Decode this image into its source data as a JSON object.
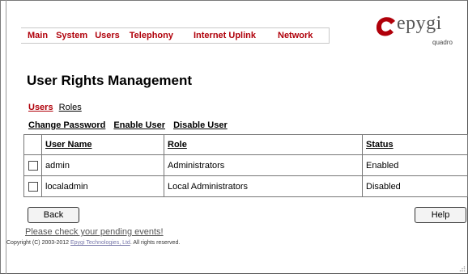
{
  "nav": {
    "items": [
      {
        "label": "Main"
      },
      {
        "label": "System"
      },
      {
        "label": "Users"
      },
      {
        "label": "Telephony"
      },
      {
        "label": "Internet Uplink"
      },
      {
        "label": "Network"
      }
    ]
  },
  "logo": {
    "word": "epygi",
    "sub": "quadro",
    "icon": "epygi-logo-icon"
  },
  "page": {
    "title": "User Rights Management"
  },
  "tabs": {
    "users": "Users",
    "roles": "Roles"
  },
  "actions": {
    "change_password": "Change Password",
    "enable_user": "Enable User",
    "disable_user": "Disable User"
  },
  "table": {
    "headers": {
      "user_name": "User Name",
      "role": "Role",
      "status": "Status"
    },
    "rows": [
      {
        "user": "admin",
        "role": "Administrators",
        "status": "Enabled"
      },
      {
        "user": "localadmin",
        "role": "Local Administrators",
        "status": "Disabled"
      }
    ]
  },
  "buttons": {
    "back": "Back",
    "help": "Help"
  },
  "footer": {
    "pending": "Please check your pending events!",
    "copyright_prefix": "Copyright (C) 2003-2012 ",
    "copyright_link": "Epygi Technologies, Ltd",
    "copyright_suffix": ". All rights reserved."
  },
  "colors": {
    "accent": "#b0000a",
    "logo_gray": "#555555",
    "border": "#777777"
  }
}
